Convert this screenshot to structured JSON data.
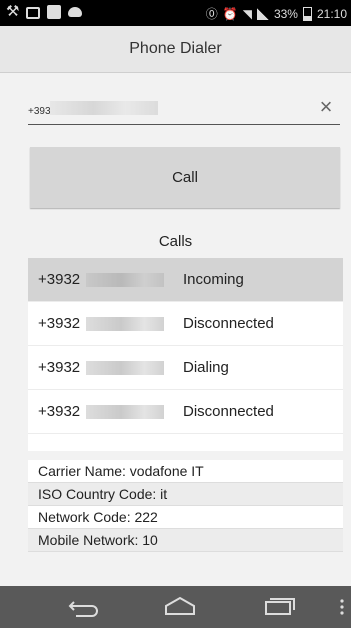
{
  "status_bar": {
    "battery": "33%",
    "time": "21:10"
  },
  "app": {
    "title": "Phone Dialer"
  },
  "dialer": {
    "number_value": "+393",
    "call_label": "Call"
  },
  "calls": {
    "heading": "Calls",
    "items": [
      {
        "number": "+3932",
        "status": "Incoming",
        "selected": true
      },
      {
        "number": "+3932",
        "status": "Disconnected",
        "selected": false
      },
      {
        "number": "+3932",
        "status": "Dialing",
        "selected": false
      },
      {
        "number": "+3932",
        "status": "Disconnected",
        "selected": false
      }
    ]
  },
  "network_info": [
    "Carrier Name: vodafone IT",
    "ISO Country Code: it",
    "Network Code: 222",
    "Mobile Network: 10"
  ],
  "icons": {
    "status_left": [
      "notification-icon",
      "mail-icon",
      "facebook-icon",
      "cloud-icon"
    ],
    "status_right": [
      "nfc-icon",
      "alarm-icon",
      "wifi-icon",
      "signal-icon",
      "battery-icon"
    ],
    "nav": [
      "back-icon",
      "home-icon",
      "recent-apps-icon",
      "overflow-menu-icon"
    ],
    "clear": "clear-icon"
  }
}
